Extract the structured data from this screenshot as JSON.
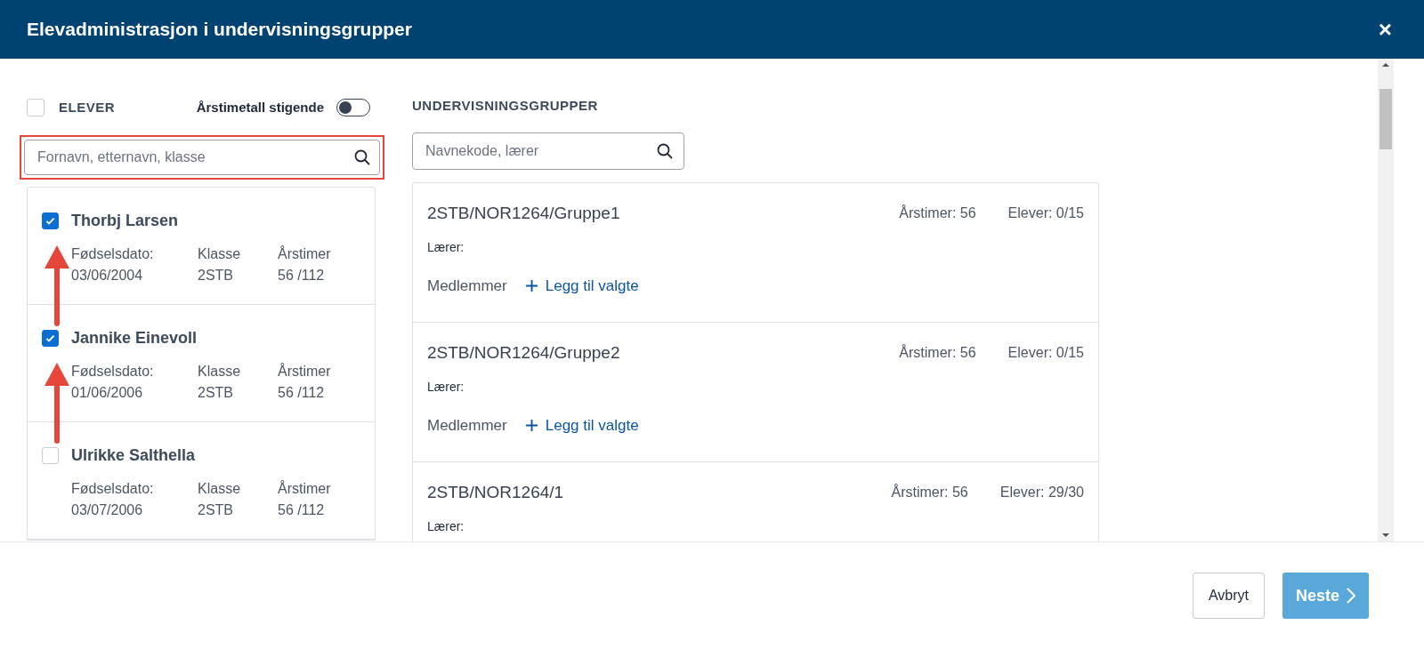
{
  "window": {
    "title": "Elevadministrasjon i undervisningsgrupper",
    "close": "×"
  },
  "students_panel": {
    "select_all": {
      "label": "ELEVER",
      "checked": false
    },
    "sort_toggle": {
      "label": "Årstimetall stigende",
      "on": false
    },
    "search": {
      "placeholder": "Fornavn, etternavn, klasse",
      "highlighted": true
    },
    "students": [
      {
        "name": "Thorbj Larsen",
        "checked": true,
        "annotated": true,
        "birth_label": "Fødselsdato:",
        "birth": "03/06/2004",
        "class_label": "Klasse",
        "class": "2STB",
        "hours_label": "Årstimer",
        "hours": "56 /112"
      },
      {
        "name": "Jannike Einevoll",
        "checked": true,
        "annotated": true,
        "birth_label": "Fødselsdato:",
        "birth": "01/06/2006",
        "class_label": "Klasse",
        "class": "2STB",
        "hours_label": "Årstimer",
        "hours": "56 /112"
      },
      {
        "name": "Ulrikke Salthella",
        "checked": false,
        "annotated": false,
        "birth_label": "Fødselsdato:",
        "birth": "03/07/2006",
        "class_label": "Klasse",
        "class": "2STB",
        "hours_label": "Årstimer",
        "hours": "56 /112"
      }
    ]
  },
  "groups_panel": {
    "title": "UNDERVISNINGSGRUPPER",
    "search": {
      "placeholder": "Navnekode, lærer"
    },
    "groups": [
      {
        "name": "2STB/NOR1264/Gruppe1",
        "hours": "Årstimer: 56",
        "students": "Elever: 0/15",
        "teacher": "Lærer:",
        "members": "Medlemmer",
        "add": "Legg til valgte"
      },
      {
        "name": "2STB/NOR1264/Gruppe2",
        "hours": "Årstimer: 56",
        "students": "Elever: 0/15",
        "teacher": "Lærer:",
        "members": "Medlemmer",
        "add": "Legg til valgte"
      },
      {
        "name": "2STB/NOR1264/1",
        "hours": "Årstimer: 56",
        "students": "Elever: 29/30",
        "teacher": "Lærer:"
      }
    ]
  },
  "footer": {
    "cancel": "Avbryt",
    "next": {
      "label": "Neste",
      "disabled": true
    }
  }
}
